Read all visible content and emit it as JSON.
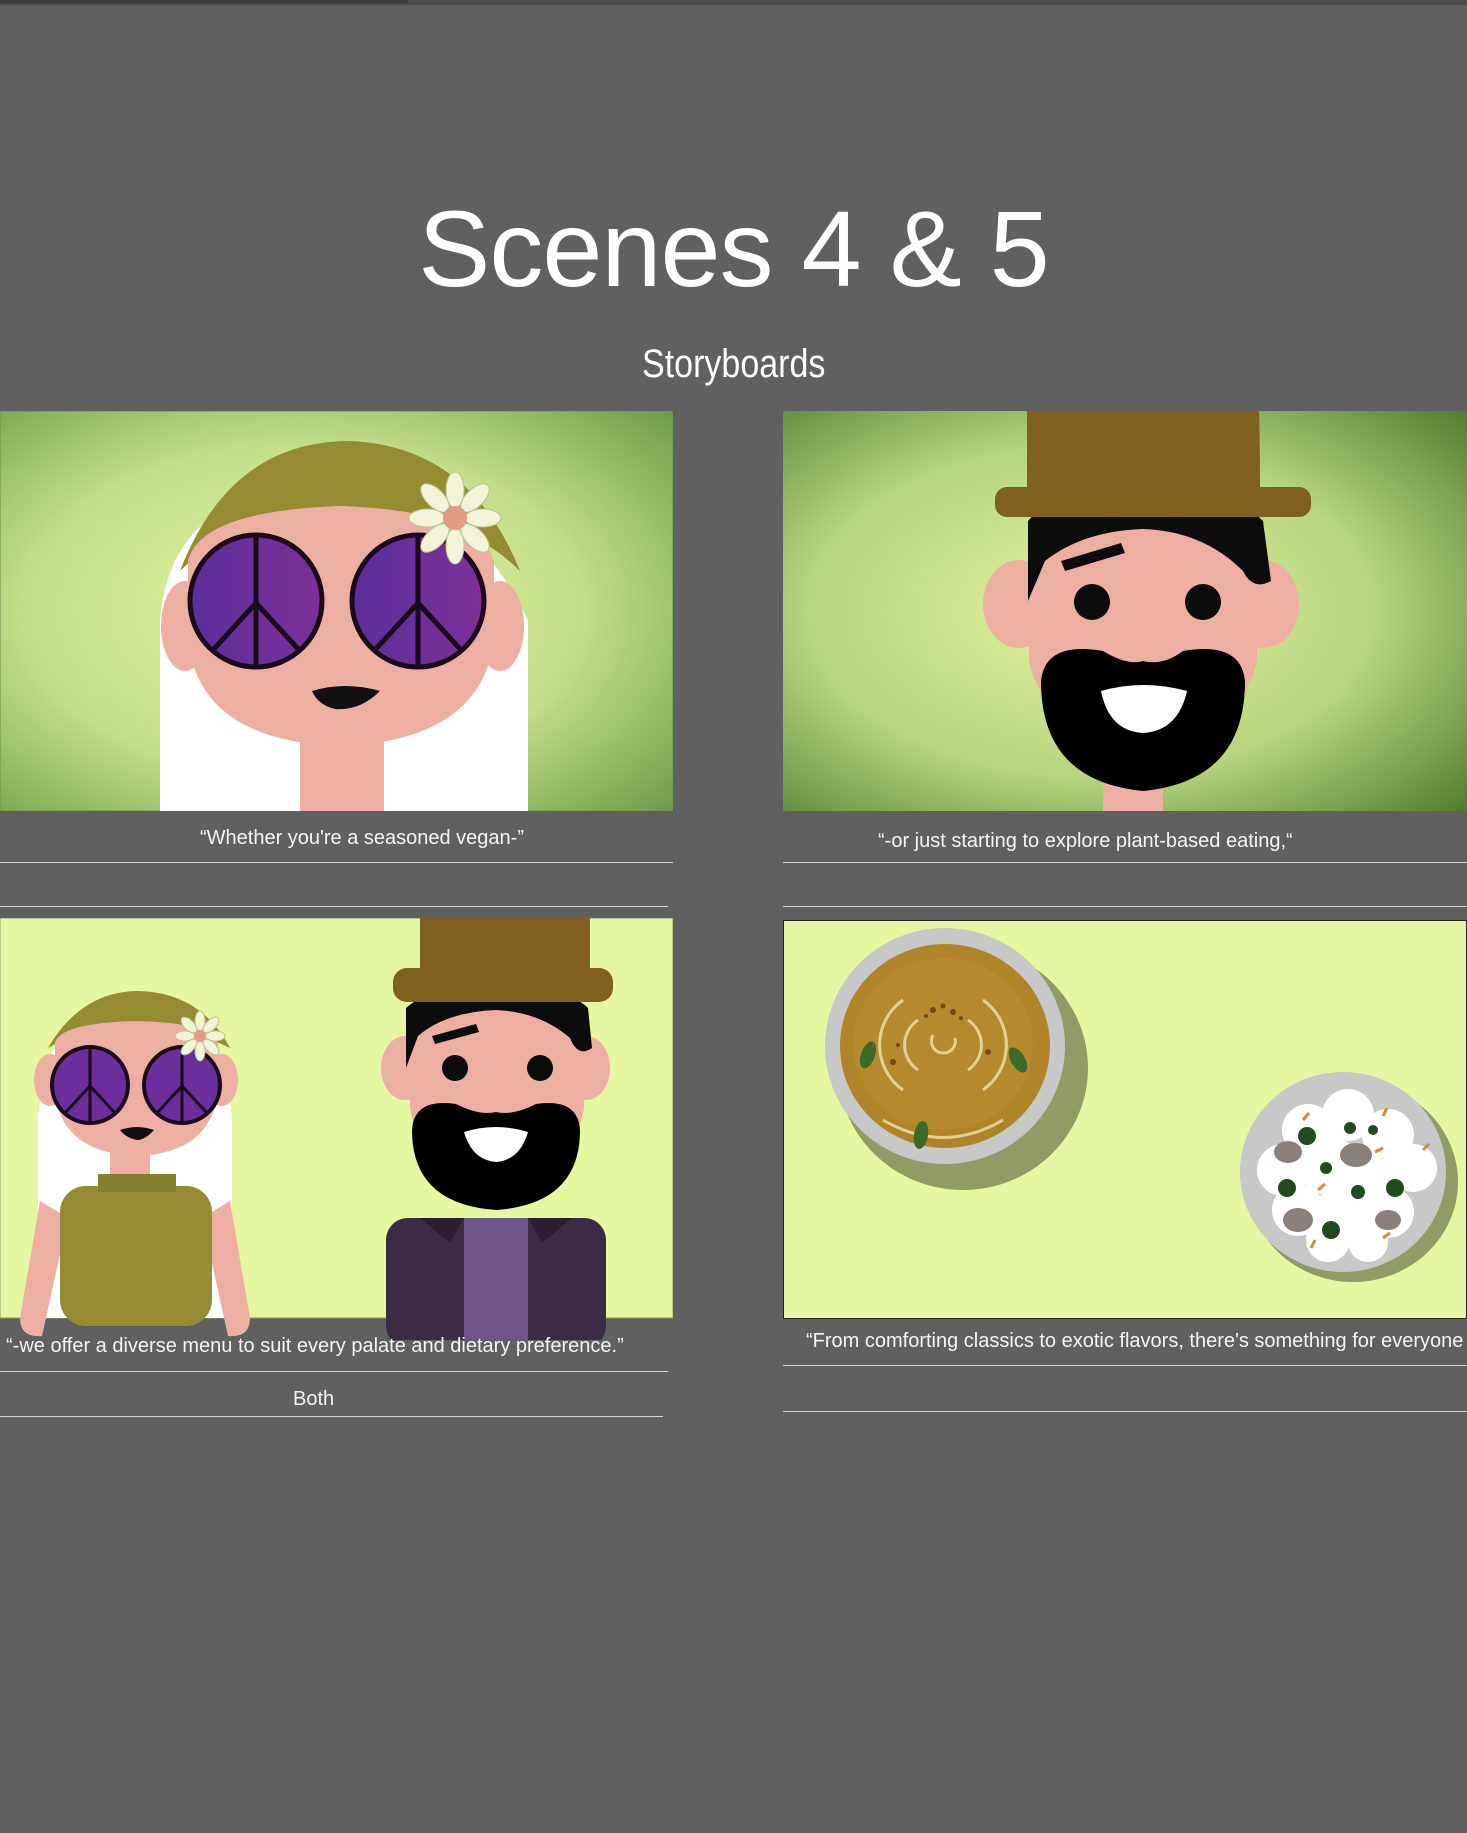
{
  "header": {
    "title": "Scenes 4 & 5",
    "subtitle": "Storyboards"
  },
  "panels": [
    {
      "caption": "“Whether you're a seasoned vegan-”",
      "note": ""
    },
    {
      "caption": "“-or just starting to explore plant-based eating,“",
      "note": ""
    },
    {
      "caption": "“-we offer a diverse menu to suit every palate and dietary preference.”",
      "note": "Both"
    },
    {
      "caption": "“From comforting classics to exotic flavors, there's something for everyone",
      "note": ""
    }
  ],
  "colors": {
    "background": "#606060",
    "panel_green_light": "#e6f5a3",
    "panel_green_dark": "#5f8a3a",
    "hat_brown": "#7f611d",
    "skin": "#eeafa3",
    "lens_purple": "#6a2f9a"
  }
}
